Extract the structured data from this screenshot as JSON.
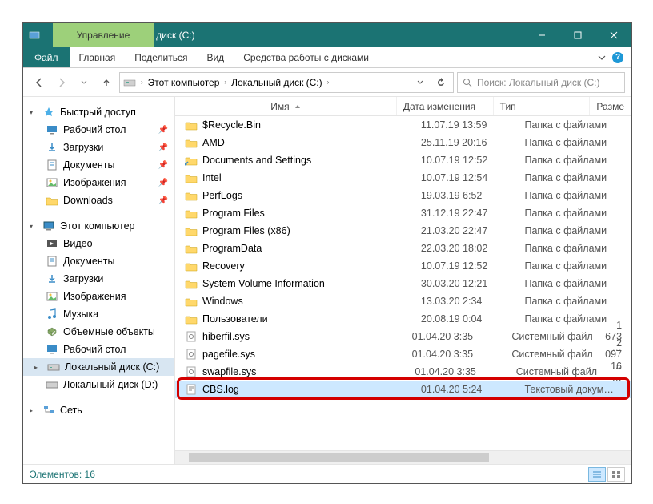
{
  "titlebar": {
    "title": "Локальный диск (C:)",
    "context_tab": "Управление",
    "min_tooltip": "Minimize",
    "max_tooltip": "Maximize",
    "close_tooltip": "Close"
  },
  "ribbon": {
    "file": "Файл",
    "tabs": [
      "Главная",
      "Поделиться",
      "Вид",
      "Средства работы с дисками"
    ]
  },
  "nav": {
    "crumbs": [
      "Этот компьютер",
      "Локальный диск (C:)"
    ],
    "search_placeholder": "Поиск: Локальный диск (C:)"
  },
  "sidebar": {
    "quick_access": {
      "label": "Быстрый доступ",
      "items": [
        {
          "label": "Рабочий стол",
          "icon": "desktop",
          "pinned": true
        },
        {
          "label": "Загрузки",
          "icon": "downloads",
          "pinned": true
        },
        {
          "label": "Документы",
          "icon": "documents",
          "pinned": true
        },
        {
          "label": "Изображения",
          "icon": "pictures",
          "pinned": true
        },
        {
          "label": "Downloads",
          "icon": "folder",
          "pinned": true
        }
      ]
    },
    "this_pc": {
      "label": "Этот компьютер",
      "items": [
        {
          "label": "Видео",
          "icon": "video"
        },
        {
          "label": "Документы",
          "icon": "documents"
        },
        {
          "label": "Загрузки",
          "icon": "downloads"
        },
        {
          "label": "Изображения",
          "icon": "pictures"
        },
        {
          "label": "Музыка",
          "icon": "music"
        },
        {
          "label": "Объемные объекты",
          "icon": "3d"
        },
        {
          "label": "Рабочий стол",
          "icon": "desktop"
        },
        {
          "label": "Локальный диск (C:)",
          "icon": "drive",
          "selected": true
        },
        {
          "label": "Локальный диск (D:)",
          "icon": "drive"
        }
      ]
    },
    "network": {
      "label": "Сеть"
    }
  },
  "columns": {
    "name": "Имя",
    "date": "Дата изменения",
    "type": "Тип",
    "size": "Разме"
  },
  "files": [
    {
      "name": "$Recycle.Bin",
      "date": "11.07.19 13:59",
      "type": "Папка с файлами",
      "size": "",
      "icon": "folder"
    },
    {
      "name": "AMD",
      "date": "25.11.19 20:16",
      "type": "Папка с файлами",
      "size": "",
      "icon": "folder"
    },
    {
      "name": "Documents and Settings",
      "date": "10.07.19 12:52",
      "type": "Папка с файлами",
      "size": "",
      "icon": "folder-link"
    },
    {
      "name": "Intel",
      "date": "10.07.19 12:54",
      "type": "Папка с файлами",
      "size": "",
      "icon": "folder"
    },
    {
      "name": "PerfLogs",
      "date": "19.03.19 6:52",
      "type": "Папка с файлами",
      "size": "",
      "icon": "folder"
    },
    {
      "name": "Program Files",
      "date": "31.12.19 22:47",
      "type": "Папка с файлами",
      "size": "",
      "icon": "folder"
    },
    {
      "name": "Program Files (x86)",
      "date": "21.03.20 22:47",
      "type": "Папка с файлами",
      "size": "",
      "icon": "folder"
    },
    {
      "name": "ProgramData",
      "date": "22.03.20 18:02",
      "type": "Папка с файлами",
      "size": "",
      "icon": "folder"
    },
    {
      "name": "Recovery",
      "date": "10.07.19 12:52",
      "type": "Папка с файлами",
      "size": "",
      "icon": "folder"
    },
    {
      "name": "System Volume Information",
      "date": "30.03.20 12:21",
      "type": "Папка с файлами",
      "size": "",
      "icon": "folder"
    },
    {
      "name": "Windows",
      "date": "13.03.20 2:34",
      "type": "Папка с файлами",
      "size": "",
      "icon": "folder"
    },
    {
      "name": "Пользователи",
      "date": "20.08.19 0:04",
      "type": "Папка с файлами",
      "size": "",
      "icon": "folder"
    },
    {
      "name": "hiberfil.sys",
      "date": "01.04.20 3:35",
      "type": "Системный файл",
      "size": "1 673 …",
      "icon": "sys"
    },
    {
      "name": "pagefile.sys",
      "date": "01.04.20 3:35",
      "type": "Системный файл",
      "size": "2 097 …",
      "icon": "sys"
    },
    {
      "name": "swapfile.sys",
      "date": "01.04.20 3:35",
      "type": "Системный файл",
      "size": "16 …",
      "icon": "sys"
    },
    {
      "name": "CBS.log",
      "date": "01.04.20 5:24",
      "type": "Текстовый докум…",
      "size": "",
      "icon": "text",
      "selected": true,
      "highlight": true
    }
  ],
  "statusbar": {
    "count_label": "Элементов: 16"
  }
}
